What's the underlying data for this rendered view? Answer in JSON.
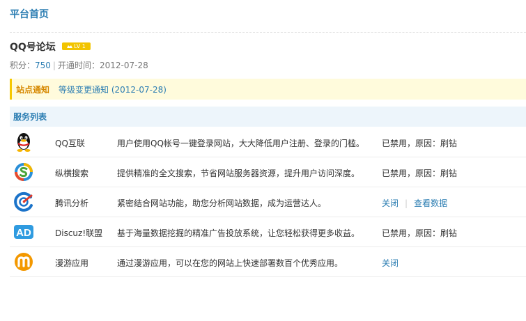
{
  "header": {
    "title": "平台首页"
  },
  "site": {
    "name": "QQ号论坛",
    "level_badge": "LV 1",
    "score_label": "积分：",
    "score_value": "750",
    "separator": "|",
    "opened_label": "开通时间：",
    "opened_date": "2012-07-28"
  },
  "notice": {
    "label": "站点通知",
    "text": "等级变更通知 (2012-07-28)"
  },
  "services": {
    "header": "服务列表",
    "items": [
      {
        "name": "QQ互联",
        "icon": "qq-penguin-icon",
        "description": "用户使用QQ帐号一键登录网站，大大降低用户注册、登录的门槛。",
        "status": "已禁用，原因：刷钻"
      },
      {
        "name": "纵横搜索",
        "icon": "search-s-icon",
        "description": "提供精准的全文搜索，节省网站服务器资源，提升用户访问深度。",
        "status": "已禁用，原因：刷钻"
      },
      {
        "name": "腾讯分析",
        "icon": "analytics-icon",
        "description": "紧密结合网站功能，助您分析网站数据，成为运营达人。",
        "actions": [
          "关闭",
          "查看数据"
        ]
      },
      {
        "name": "Discuz!联盟",
        "icon": "ad-icon",
        "description": "基于海量数据挖掘的精准广告投放系统，让您轻松获得更多收益。",
        "status": "已禁用，原因：刷钻"
      },
      {
        "name": "漫游应用",
        "icon": "manyou-m-icon",
        "description": "通过漫游应用，可以在您的网站上快速部署数百个优秀应用。",
        "actions": [
          "关闭"
        ]
      }
    ]
  },
  "colors": {
    "accent": "#2b7db2",
    "notice_bg": "#fffbdc",
    "notice_border": "#f6c800",
    "notice_label": "#d68800",
    "section_bg": "#edf5fb"
  }
}
